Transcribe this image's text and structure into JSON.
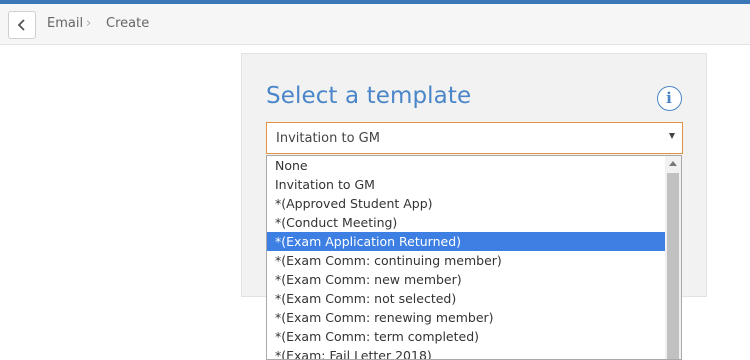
{
  "breadcrumb": {
    "items": [
      "Email",
      "Create"
    ],
    "separator": "›"
  },
  "panel": {
    "title": "Select a template",
    "info_icon": "info-icon"
  },
  "template_select": {
    "selected_value": "Invitation to GM",
    "highlighted_option": "*(Exam Application Returned)",
    "options": [
      "None",
      "Invitation to GM",
      "*(Approved Student App)",
      "*(Conduct Meeting)",
      "*(Exam Application Returned)",
      "*(Exam Comm: continuing member)",
      "*(Exam Comm: new member)",
      "*(Exam Comm: not selected)",
      "*(Exam Comm: renewing member)",
      "*(Exam Comm: term completed)",
      "*(Exam: Fail Letter 2018)"
    ]
  },
  "colors": {
    "accent": "#3c78b8",
    "title": "#4a86c8",
    "select_border": "#e09340",
    "highlight": "#3d7fe3"
  }
}
